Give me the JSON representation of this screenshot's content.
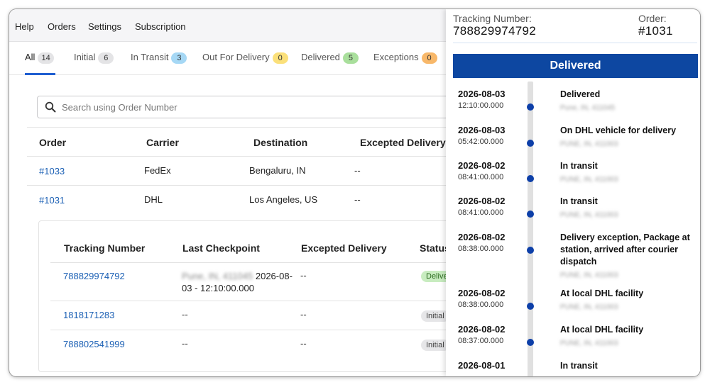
{
  "nav": {
    "items": [
      "Help",
      "Orders",
      "Settings",
      "Subscription"
    ]
  },
  "tabs": [
    {
      "label": "All",
      "count": "14",
      "badge_color": "#e4e4e6"
    },
    {
      "label": "Initial",
      "count": "6",
      "badge_color": "#e4e4e6"
    },
    {
      "label": "In Transit",
      "count": "3",
      "badge_color": "#a6d8f5"
    },
    {
      "label": "Out For Delivery",
      "count": "0",
      "badge_color": "#fbe07a"
    },
    {
      "label": "Delivered",
      "count": "5",
      "badge_color": "#a9df9c"
    },
    {
      "label": "Exceptions",
      "count": "0",
      "badge_color": "#f8b86a"
    }
  ],
  "search": {
    "placeholder": "Search using Order Number",
    "value": ""
  },
  "orders_table": {
    "headers": [
      "Order",
      "Carrier",
      "Destination",
      "Excepted Delivery"
    ],
    "rows": [
      {
        "order": "#1033",
        "carrier": "FedEx",
        "destination": "Bengaluru, IN",
        "expected": "--"
      },
      {
        "order": "#1031",
        "carrier": "DHL",
        "destination": "Los Angeles, US",
        "expected": "--"
      }
    ]
  },
  "tracking_table": {
    "headers": [
      "Tracking Number",
      "Last Checkpoint",
      "Excepted Delivery",
      "Status"
    ],
    "rows": [
      {
        "tracking": "788829974792",
        "checkpoint_location": "Pune, IN, 411045",
        "checkpoint_time_1": "2026-08-",
        "checkpoint_time_2": "03 - 12:10:00.000",
        "expected": "--",
        "status": "Delivered",
        "status_bg": "#c8ecc0",
        "status_fg": "#2b6a1e"
      },
      {
        "tracking": "1818171283",
        "checkpoint": "--",
        "expected": "--",
        "status": "Initial",
        "status_bg": "#e6e6e8",
        "status_fg": "#444"
      },
      {
        "tracking": "788802541999",
        "checkpoint": "--",
        "expected": "--",
        "status": "Initial",
        "status_bg": "#e6e6e8",
        "status_fg": "#444"
      }
    ]
  },
  "drawer": {
    "tracking_label": "Tracking Number:",
    "tracking_value": "788829974792",
    "order_label": "Order:",
    "order_value": "#1031",
    "status_banner": "Delivered",
    "status_color": "#0d47a1",
    "events": [
      {
        "date": "2026-08-03",
        "time": "12:10:00.000",
        "title": "Delivered",
        "location": "Pune, IN, 411045"
      },
      {
        "date": "2026-08-03",
        "time": "05:42:00.000",
        "title": "On DHL vehicle for delivery",
        "location": "PUNE, IN, 411003"
      },
      {
        "date": "2026-08-02",
        "time": "08:41:00.000",
        "title": "In transit",
        "location": "PUNE, IN, 411003"
      },
      {
        "date": "2026-08-02",
        "time": "08:41:00.000",
        "title": "In transit",
        "location": "PUNE, IN, 411003"
      },
      {
        "date": "2026-08-02",
        "time": "08:38:00.000",
        "title": "Delivery exception, Package at station, arrived after courier dispatch",
        "location": "PUNE, IN, 411003"
      },
      {
        "date": "2026-08-02",
        "time": "08:38:00.000",
        "title": "At local DHL facility",
        "location": "PUNE, IN, 411003"
      },
      {
        "date": "2026-08-02",
        "time": "08:37:00.000",
        "title": "At local DHL facility",
        "location": "PUNE, IN, 411003"
      },
      {
        "date": "2026-08-01",
        "time": "",
        "title": "In transit",
        "location": ""
      }
    ]
  }
}
